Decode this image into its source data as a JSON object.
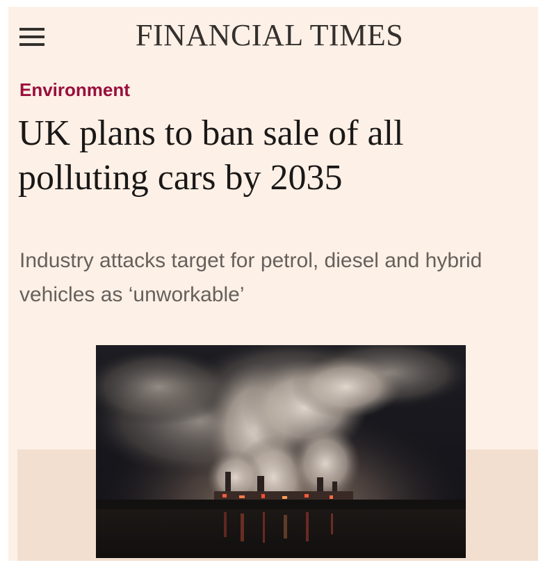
{
  "masthead": {
    "brand": "FINANCIAL TIMES",
    "menu_icon": "hamburger-menu-icon"
  },
  "article": {
    "section": "Environment",
    "headline": "UK plans to ban sale of all polluting cars by 2035",
    "standfirst": "Industry attacks target for petrol, diesel and hybrid vehicles as ‘unworkable’",
    "image": "power-station-emitting-smoke-at-night"
  },
  "colors": {
    "page_background": "#fdf0e6",
    "section_label": "#990f3d",
    "headline": "#1a1817",
    "standfirst": "#66605c",
    "image_band": "#f2dfd0"
  }
}
